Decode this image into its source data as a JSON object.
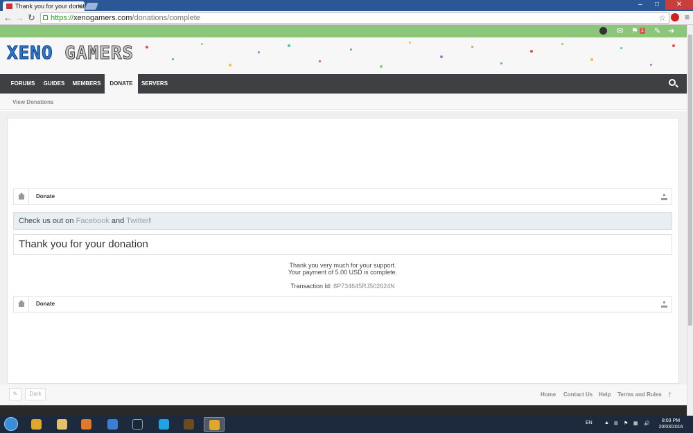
{
  "browser": {
    "tab_title": "Thank you for your donat",
    "url_scheme": "https://",
    "url_host": "xenogamers.com",
    "url_path": "/donations/complete",
    "ext_badge": "1"
  },
  "topbar": {
    "alerts_count": "1"
  },
  "site": {
    "logo_part1": "XENO",
    "logo_part2": "GAMERS"
  },
  "nav": {
    "items": [
      {
        "label": "FORUMS"
      },
      {
        "label": "GUIDES"
      },
      {
        "label": "MEMBERS"
      },
      {
        "label": "DONATE"
      },
      {
        "label": "SERVERS"
      }
    ],
    "active": "DONATE",
    "subnav_label": "View Donations"
  },
  "breadcrumb": {
    "current": "Donate"
  },
  "notice": {
    "prefix": "Check us out on ",
    "link1": "Facebook",
    "middle": " and ",
    "link2": "Twitter",
    "suffix": "!"
  },
  "page_title": "Thank you for your donation",
  "message": {
    "line1": "Thank you very much for your support.",
    "line2": "Your payment of 5.00 USD is complete.",
    "txn_label": "Transaction Id: ",
    "txn_id": "8P734645RJ502624N"
  },
  "footer": {
    "style_label": "Dark",
    "links": [
      "Home",
      "Contact Us",
      "Help",
      "Terms and Rules"
    ]
  },
  "taskbar": {
    "lang": "EN",
    "time": "8:03 PM",
    "date": "20/03/2016"
  }
}
